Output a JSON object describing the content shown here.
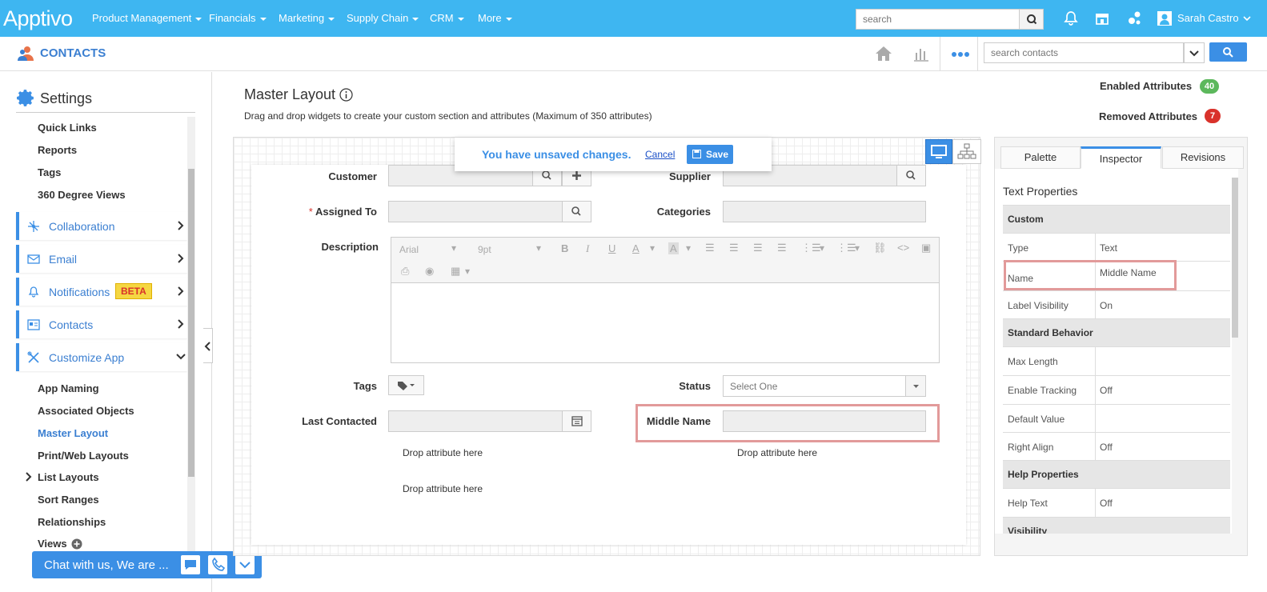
{
  "app": {
    "logo": "Apptivo"
  },
  "topnav": [
    {
      "label": "Product Management"
    },
    {
      "label": "Financials"
    },
    {
      "label": "Marketing"
    },
    {
      "label": "Supply Chain"
    },
    {
      "label": "CRM"
    },
    {
      "label": "More"
    }
  ],
  "top": {
    "search_placeholder": "search",
    "user": "Sarah Castro"
  },
  "subheader": {
    "title": "CONTACTS",
    "search_placeholder": "search contacts"
  },
  "sidebar": {
    "title": "Settings",
    "top_items": [
      "Quick Links",
      "Reports",
      "Tags",
      "360 Degree Views"
    ],
    "groups": [
      {
        "label": "Collaboration"
      },
      {
        "label": "Email"
      },
      {
        "label": "Notifications",
        "badge": "BETA"
      },
      {
        "label": "Contacts"
      },
      {
        "label": "Customize App"
      }
    ],
    "sub_items": [
      "App Naming",
      "Associated Objects",
      "Master Layout",
      "Print/Web Layouts",
      "List Layouts",
      "Sort Ranges",
      "Relationships",
      "Views"
    ],
    "active_item": "Master Layout"
  },
  "chat": {
    "label": "Chat with us, We are ..."
  },
  "main": {
    "title": "Master Layout",
    "subtitle": "Drag and drop widgets to create your custom section and attributes (Maximum of 350 attributes)",
    "enabled_label": "Enabled Attributes",
    "enabled_count": "40",
    "removed_label": "Removed Attributes",
    "removed_count": "7"
  },
  "banner": {
    "message": "You have unsaved changes.",
    "cancel": "Cancel",
    "save": "Save"
  },
  "form": {
    "customer": "Customer",
    "supplier": "Supplier",
    "assigned_to": "Assigned To",
    "required_mark": "*",
    "categories": "Categories",
    "description": "Description",
    "tags": "Tags",
    "status": "Status",
    "status_value": "Select One",
    "last_contacted": "Last Contacted",
    "middle_name": "Middle Name",
    "drop_here": "Drop attribute here",
    "editor_font": "Arial",
    "editor_size": "9pt"
  },
  "inspector": {
    "tabs": [
      "Palette",
      "Inspector",
      "Revisions"
    ],
    "active_tab": "Inspector",
    "section_title": "Text Properties",
    "sections": {
      "custom": "Custom",
      "standard": "Standard Behavior",
      "help": "Help Properties",
      "visibility": "Visibility"
    },
    "rows": {
      "type": {
        "key": "Type",
        "value": "Text"
      },
      "name": {
        "key": "Name",
        "value": "Middle Name"
      },
      "label_visibility": {
        "key": "Label Visibility",
        "value": "On"
      },
      "max_length": {
        "key": "Max Length",
        "value": ""
      },
      "enable_tracking": {
        "key": "Enable Tracking",
        "value": "Off"
      },
      "default_value": {
        "key": "Default Value",
        "value": ""
      },
      "right_align": {
        "key": "Right Align",
        "value": "Off"
      },
      "help_text": {
        "key": "Help Text",
        "value": "Off"
      }
    }
  },
  "colors": {
    "topbar": "#3eb6f1",
    "accent": "#3b8fe5",
    "enabled_badge": "#5cb85c",
    "removed_badge": "#d9322b",
    "highlight": "#e29a9a"
  }
}
